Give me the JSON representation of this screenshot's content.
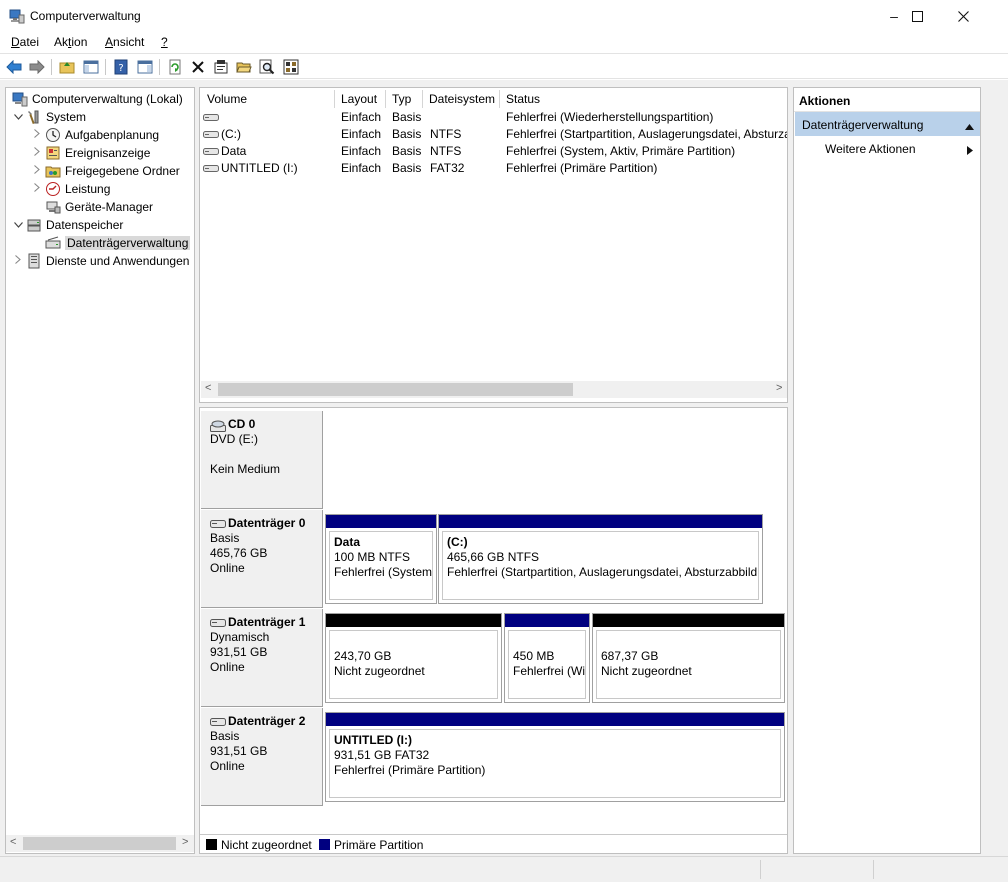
{
  "window": {
    "title": "Computerverwaltung",
    "controls": {
      "minimize": "–",
      "maximize": "☐",
      "close": "✕"
    }
  },
  "menu": {
    "items": [
      {
        "label": "Datei",
        "underline": "D",
        "rest": "atei"
      },
      {
        "label": "Aktion",
        "pre": "Ak",
        "underline": "t",
        "rest": "ion"
      },
      {
        "label": "Ansicht",
        "underline": "A",
        "rest": "nsicht"
      },
      {
        "label": "?",
        "underline": "?"
      }
    ]
  },
  "toolbar": {
    "icons": [
      "back-arrow-icon",
      "forward-arrow-icon",
      "up-folder-icon",
      "show-hide-tree-icon",
      "help-icon",
      "show-hide-action-pane-icon",
      "refresh-icon",
      "delete-icon",
      "properties-icon",
      "open-icon",
      "search-icon",
      "settings-icon"
    ]
  },
  "tree": {
    "items": [
      {
        "label": "Computerverwaltung (Lokal)",
        "level": 0,
        "expander": "",
        "icon": "computer-management-icon"
      },
      {
        "label": "System",
        "level": 1,
        "expander": "v",
        "icon": "tools-icon"
      },
      {
        "label": "Aufgabenplanung",
        "level": 2,
        "expander": ">",
        "icon": "clock-icon"
      },
      {
        "label": "Ereignisanzeige",
        "level": 2,
        "expander": ">",
        "icon": "event-viewer-icon"
      },
      {
        "label": "Freigegebene Ordner",
        "level": 2,
        "expander": ">",
        "icon": "shared-folder-icon"
      },
      {
        "label": "Leistung",
        "level": 2,
        "expander": ">",
        "icon": "performance-icon"
      },
      {
        "label": "Geräte-Manager",
        "level": 2,
        "expander": "",
        "icon": "device-manager-icon"
      },
      {
        "label": "Datenspeicher",
        "level": 1,
        "expander": "v",
        "icon": "storage-icon"
      },
      {
        "label": "Datenträgerverwaltung",
        "level": 2,
        "expander": "",
        "icon": "disk-management-icon",
        "selected": true
      },
      {
        "label": "Dienste und Anwendungen",
        "level": 1,
        "expander": ">",
        "icon": "services-icon"
      }
    ]
  },
  "volumes": {
    "columns": [
      "Volume",
      "Layout",
      "Typ",
      "Dateisystem",
      "Status"
    ],
    "rows": [
      {
        "volume": "",
        "layout": "Einfach",
        "typ": "Basis",
        "dateisystem": "",
        "status": "Fehlerfrei (Wiederherstellungspartition)"
      },
      {
        "volume": "(C:)",
        "layout": "Einfach",
        "typ": "Basis",
        "dateisystem": "NTFS",
        "status": "Fehlerfrei (Startpartition, Auslagerungsdatei, Absturza"
      },
      {
        "volume": "Data",
        "layout": "Einfach",
        "typ": "Basis",
        "dateisystem": "NTFS",
        "status": "Fehlerfrei (System, Aktiv, Primäre Partition)"
      },
      {
        "volume": "UNTITLED (I:)",
        "layout": "Einfach",
        "typ": "Basis",
        "dateisystem": "FAT32",
        "status": "Fehlerfrei (Primäre Partition)"
      }
    ]
  },
  "disks": [
    {
      "name": "CD 0",
      "line1": "DVD (E:)",
      "line2": "",
      "line3": "Kein Medium",
      "partitions": []
    },
    {
      "name": "Datenträger 0",
      "line1": "Basis",
      "line2": "465,76 GB",
      "line3": "Online",
      "partitions": [
        {
          "title": "Data",
          "size": "100 MB NTFS",
          "status": "Fehlerfrei (System,",
          "kind": "primary"
        },
        {
          "title": "(C:)",
          "size": "465,66 GB NTFS",
          "status": "Fehlerfrei (Startpartition, Auslagerungsdatei, Absturzabbild",
          "kind": "primary"
        }
      ]
    },
    {
      "name": "Datenträger 1",
      "line1": "Dynamisch",
      "line2": "931,51 GB",
      "line3": "Online",
      "partitions": [
        {
          "title": "",
          "size": "243,70 GB",
          "status": "Nicht zugeordnet",
          "kind": "unallocated"
        },
        {
          "title": "",
          "size": "450 MB",
          "status": "Fehlerfrei (Wi",
          "kind": "primary"
        },
        {
          "title": "",
          "size": "687,37 GB",
          "status": "Nicht zugeordnet",
          "kind": "unallocated"
        }
      ]
    },
    {
      "name": "Datenträger 2",
      "line1": "Basis",
      "line2": "931,51 GB",
      "line3": "Online",
      "partitions": [
        {
          "title": "UNTITLED  (I:)",
          "size": "931,51 GB FAT32",
          "status": "Fehlerfrei (Primäre Partition)",
          "kind": "primary"
        }
      ]
    }
  ],
  "legend": {
    "unallocated": "Nicht zugeordnet",
    "primary": "Primäre Partition"
  },
  "actions": {
    "header": "Aktionen",
    "section": "Datenträgerverwaltung",
    "more": "Weitere Aktionen"
  },
  "colors": {
    "primary_partition": "#000080",
    "unallocated": "#000000",
    "selection": "#b9d1ea"
  }
}
